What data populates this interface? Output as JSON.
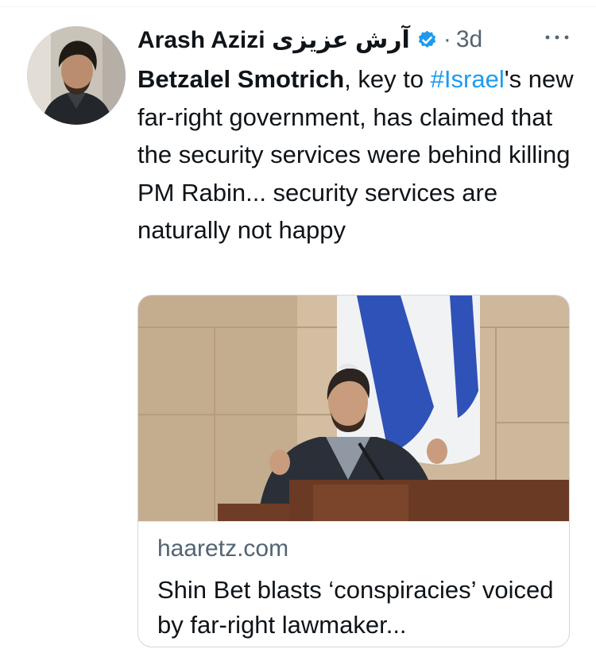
{
  "tweet": {
    "author_name": "Arash Azizi آرش عزیزی",
    "verified_icon": "verified-badge-icon",
    "separator": "·",
    "timestamp": "3d",
    "more_icon": "more-options-icon",
    "text": {
      "mention": "Betzalel Smotrich",
      "part1": ", key to ",
      "hashtag": "#Israel",
      "part2": "'s new far-right government, has claimed that the security services were behind killing PM Rabin... security services are naturally not happy"
    }
  },
  "link_card": {
    "domain": "haaretz.com",
    "title": "Shin Bet blasts ‘conspiracies’ voiced by far-right lawmaker..."
  },
  "colors": {
    "text": "#0f1419",
    "secondary": "#536471",
    "link": "#1d9bf0",
    "border": "#cfd9de"
  }
}
